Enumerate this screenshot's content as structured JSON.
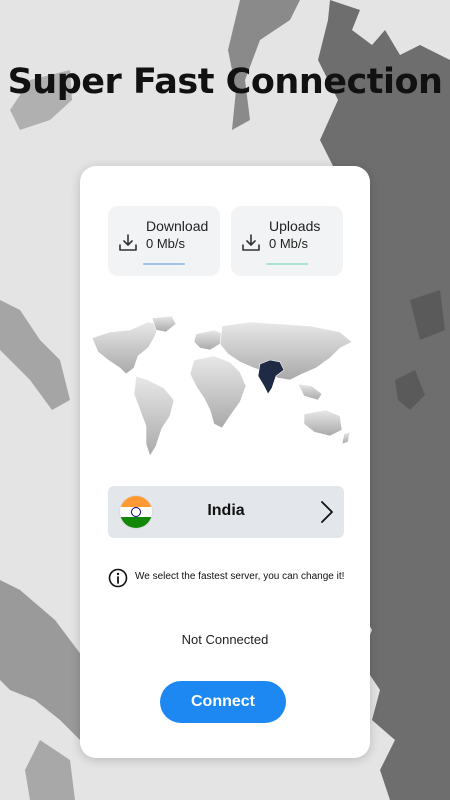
{
  "headline": "Super Fast Connection",
  "stats": {
    "download": {
      "label": "Download",
      "value": "0 Mb/s",
      "icon": "download-icon"
    },
    "upload": {
      "label": "Uploads",
      "value": "0 Mb/s",
      "icon": "download-icon"
    }
  },
  "server": {
    "country": "India",
    "flag": "india-flag",
    "chevron": "chevron-right-icon"
  },
  "info_text": "We select the fastest server, you can change it!",
  "status_text": "Not Connected",
  "connect_label": "Connect",
  "colors": {
    "accent": "#1e88f2",
    "highlight_country": "#1f2a44",
    "download_bar": "#9fc4ea",
    "upload_bar": "#a8e6cf"
  }
}
